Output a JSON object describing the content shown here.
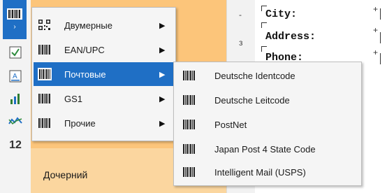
{
  "menu": {
    "items": [
      {
        "label": "Двумерные",
        "icon": "qr-code-icon",
        "has_submenu": true
      },
      {
        "label": "EAN/UPC",
        "icon": "barcode-icon",
        "has_submenu": true
      },
      {
        "label": "Почтовые",
        "icon": "barcode-icon",
        "has_submenu": true,
        "highlighted": true
      },
      {
        "label": "GS1",
        "icon": "barcode-icon",
        "has_submenu": true
      },
      {
        "label": "Прочие",
        "icon": "barcode-icon",
        "has_submenu": true
      }
    ]
  },
  "submenu": {
    "items": [
      {
        "label": "Deutsche Identcode",
        "icon": "barcode-icon"
      },
      {
        "label": "Deutsche Leitcode",
        "icon": "barcode-icon"
      },
      {
        "label": "PostNet",
        "icon": "barcode-icon"
      },
      {
        "label": "Japan Post 4 State Code",
        "icon": "barcode-icon"
      },
      {
        "label": "Intelligent Mail (USPS)",
        "icon": "barcode-icon"
      }
    ]
  },
  "band": {
    "label": "Дочерний"
  },
  "gutter": {
    "marks": [
      "-",
      "з"
    ]
  },
  "report": {
    "fields": [
      "City:",
      "Address:",
      "Phone:"
    ]
  },
  "toolbar": {
    "tools": [
      "barcode-tool-icon",
      "checkbox-tool-icon",
      "text-tool-icon",
      "chart-tool-icon",
      "sparkline-tool-icon",
      "number-tool-icon"
    ],
    "number_tool_text": "12"
  },
  "colors": {
    "accent": "#1f6fc5",
    "band": "#fcc57a",
    "menu_bg": "#f5f5f5"
  }
}
